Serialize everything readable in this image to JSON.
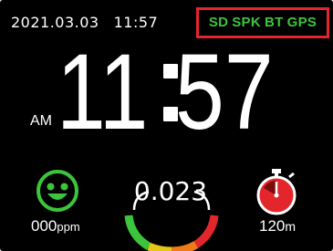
{
  "header": {
    "date": "2021.03.03",
    "time": "11:57"
  },
  "status": {
    "items": [
      "SD",
      "SPK",
      "BT",
      "GPS"
    ],
    "text_color": "#3cc43c",
    "border_color": "#e3262b"
  },
  "clock": {
    "ampm": "AM",
    "hours": "11",
    "minutes": "57"
  },
  "air_quality": {
    "icon": "smiley-face-icon",
    "value": "000",
    "unit": "ppm",
    "color": "#3cc43c"
  },
  "gauge": {
    "value": "0.023",
    "colors": [
      "#3cc43c",
      "#e6c619",
      "#ef7a1a",
      "#e3262b"
    ]
  },
  "distance": {
    "icon": "stopwatch-icon",
    "value": "120",
    "unit": "m",
    "color": "#e3262b"
  }
}
